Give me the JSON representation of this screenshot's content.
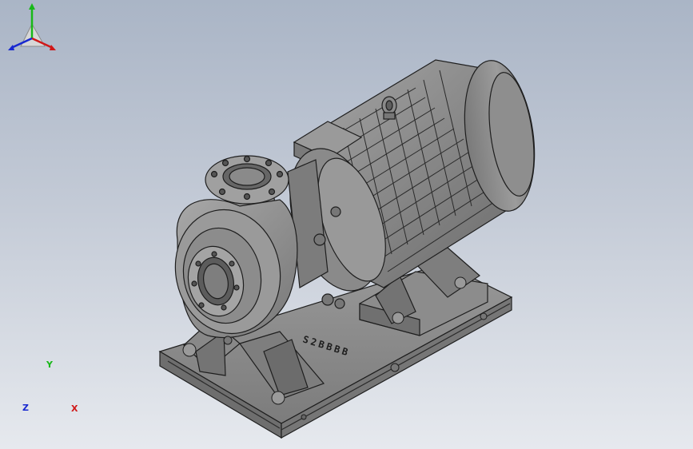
{
  "viewport": {
    "background_top": "#aab5c6",
    "background_bottom": "#e6e9ee"
  },
  "model": {
    "description_icon": "centrifugal-pump-motor-model",
    "shading": "#8a8a8a",
    "edge_color": "#1e1e1e",
    "nameplate_text": "S2BBBB"
  },
  "triad": {
    "x_label": "X",
    "y_label": "Y",
    "z_label": "Z",
    "x_color": "#d01818",
    "y_color": "#18b818",
    "z_color": "#1828d0"
  }
}
